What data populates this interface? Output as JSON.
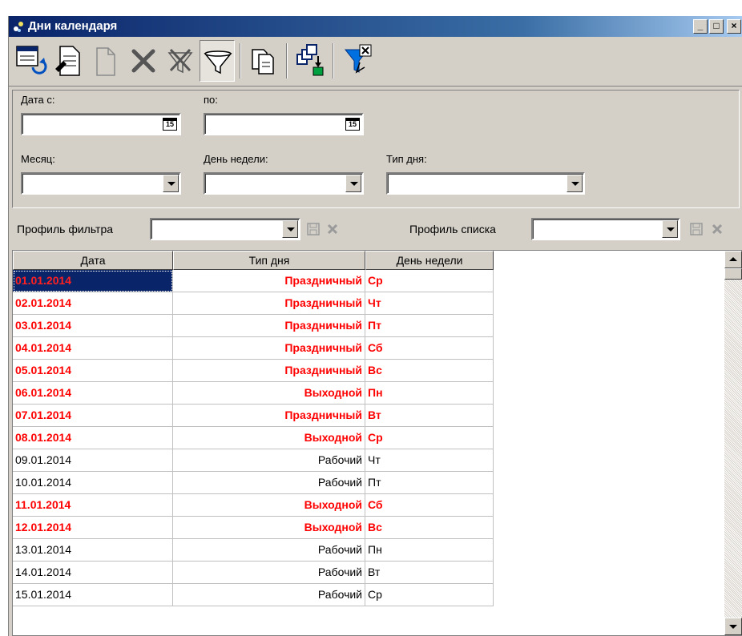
{
  "window": {
    "title": "Дни календаря"
  },
  "caption_buttons": {
    "minimize": "_",
    "maximize": "□",
    "close": "×"
  },
  "toolbar": {
    "icons": [
      "refresh-icon",
      "edit-document-icon",
      "new-document-icon",
      "delete-icon",
      "clear-filter-icon",
      "filter-icon",
      "copy-icon",
      "export-icon",
      "filter-settings-icon"
    ]
  },
  "filters": {
    "date_from_label": "Дата с:",
    "date_from_value": "",
    "date_to_label": "по:",
    "date_to_value": "",
    "calendar_glyph": "15",
    "month_label": "Месяц:",
    "month_value": "",
    "weekday_label": "День недели:",
    "weekday_value": "",
    "daytype_label": "Тип дня:",
    "daytype_value": ""
  },
  "profiles": {
    "filter_profile_label": "Профиль фильтра",
    "filter_profile_value": "",
    "list_profile_label": "Профиль списка",
    "list_profile_value": ""
  },
  "grid": {
    "columns": [
      "Дата",
      "Тип дня",
      "День недели"
    ],
    "rows": [
      {
        "date": "01.01.2014",
        "type": "Праздничный",
        "weekday": "Ср",
        "highlight": true,
        "selected": true
      },
      {
        "date": "02.01.2014",
        "type": "Праздничный",
        "weekday": "Чт",
        "highlight": true
      },
      {
        "date": "03.01.2014",
        "type": "Праздничный",
        "weekday": "Пт",
        "highlight": true
      },
      {
        "date": "04.01.2014",
        "type": "Праздничный",
        "weekday": "Сб",
        "highlight": true
      },
      {
        "date": "05.01.2014",
        "type": "Праздничный",
        "weekday": "Вс",
        "highlight": true
      },
      {
        "date": "06.01.2014",
        "type": "Выходной",
        "weekday": "Пн",
        "highlight": true
      },
      {
        "date": "07.01.2014",
        "type": "Праздничный",
        "weekday": "Вт",
        "highlight": true
      },
      {
        "date": "08.01.2014",
        "type": "Выходной",
        "weekday": "Ср",
        "highlight": true
      },
      {
        "date": "09.01.2014",
        "type": "Рабочий",
        "weekday": "Чт",
        "highlight": false
      },
      {
        "date": "10.01.2014",
        "type": "Рабочий",
        "weekday": "Пт",
        "highlight": false
      },
      {
        "date": "11.01.2014",
        "type": "Выходной",
        "weekday": "Сб",
        "highlight": true
      },
      {
        "date": "12.01.2014",
        "type": "Выходной",
        "weekday": "Вс",
        "highlight": true
      },
      {
        "date": "13.01.2014",
        "type": "Рабочий",
        "weekday": "Пн",
        "highlight": false
      },
      {
        "date": "14.01.2014",
        "type": "Рабочий",
        "weekday": "Вт",
        "highlight": false
      },
      {
        "date": "15.01.2014",
        "type": "Рабочий",
        "weekday": "Ср",
        "highlight": false
      }
    ]
  },
  "colors": {
    "titlebar": "#0a246a",
    "holiday_text": "#ff0000",
    "face": "#d4d0c8",
    "selection": "#0a246a"
  }
}
